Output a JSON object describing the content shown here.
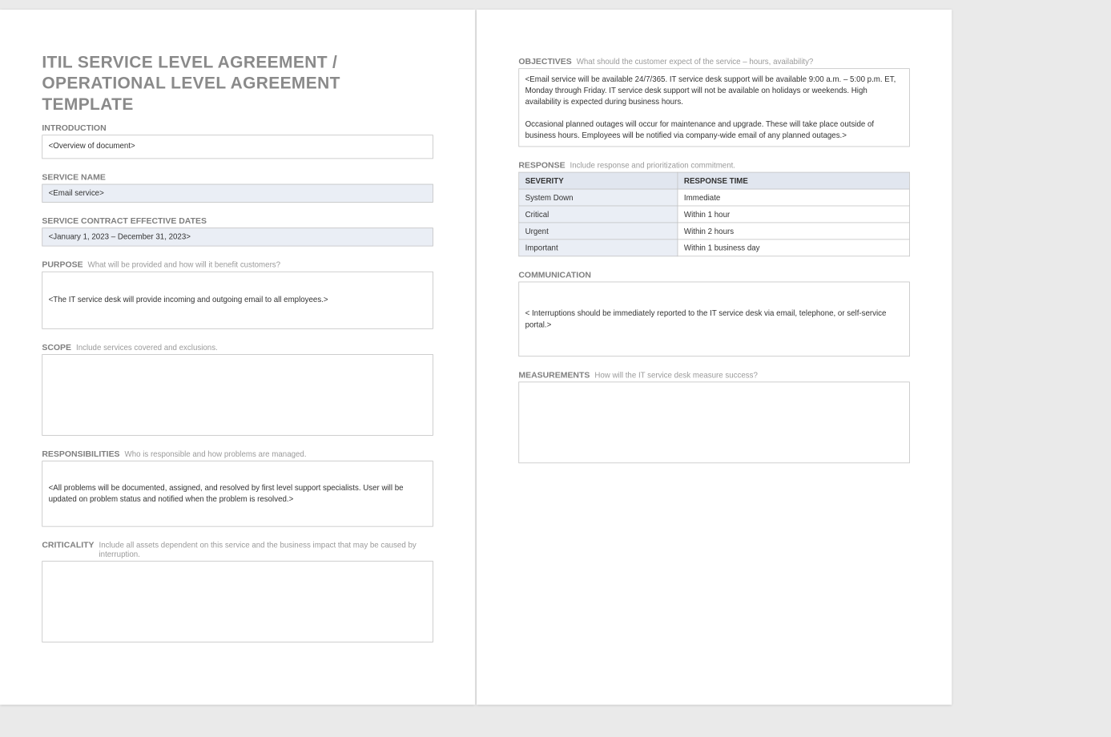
{
  "title": "ITIL SERVICE LEVEL AGREEMENT / OPERATIONAL LEVEL AGREEMENT TEMPLATE",
  "left": {
    "intro": {
      "label": "INTRODUCTION",
      "value": "<Overview of document>"
    },
    "serviceName": {
      "label": "SERVICE NAME",
      "value": "<Email service>"
    },
    "dates": {
      "label": "SERVICE CONTRACT EFFECTIVE DATES",
      "value": "<January 1, 2023 – December 31, 2023>"
    },
    "purpose": {
      "label": "PURPOSE",
      "hint": "What will be provided and how will it benefit customers?",
      "value": "<The IT service desk will provide incoming and outgoing email to all employees.>"
    },
    "scope": {
      "label": "SCOPE",
      "hint": "Include services covered and exclusions.",
      "value": ""
    },
    "resp": {
      "label": "RESPONSIBILITIES",
      "hint": "Who is responsible and how problems are managed.",
      "value": "<All problems will be documented, assigned, and resolved by first level support specialists. User will be updated on problem status and notified when the problem is resolved.>"
    },
    "crit": {
      "label": "CRITICALITY",
      "hint": "Include all assets dependent on this service and the business impact that may be caused by interruption.",
      "value": ""
    }
  },
  "right": {
    "objectives": {
      "label": "OBJECTIVES",
      "hint": "What should the customer expect of the service – hours, availability?",
      "value": "<Email service will be available 24/7/365. IT service desk support will be available 9:00 a.m. – 5:00 p.m. ET, Monday through Friday. IT service desk support will not be available on holidays or weekends. High availability is expected during business hours.\n\nOccasional planned outages will occur for maintenance and upgrade. These will take place outside of business hours. Employees will be notified via company-wide email of any planned outages.>"
    },
    "response": {
      "label": "RESPONSE",
      "hint": "Include response and prioritization commitment.",
      "headers": {
        "severity": "SEVERITY",
        "time": "RESPONSE TIME"
      },
      "rows": [
        {
          "severity": "System Down",
          "time": "Immediate"
        },
        {
          "severity": "Critical",
          "time": "Within 1 hour"
        },
        {
          "severity": "Urgent",
          "time": "Within 2 hours"
        },
        {
          "severity": "Important",
          "time": "Within 1 business day"
        }
      ]
    },
    "comm": {
      "label": "COMMUNICATION",
      "value": "< Interruptions should be immediately reported to the IT service desk via email, telephone, or self-service portal.>"
    },
    "meas": {
      "label": "MEASUREMENTS",
      "hint": "How will the IT service desk measure success?",
      "value": ""
    }
  }
}
